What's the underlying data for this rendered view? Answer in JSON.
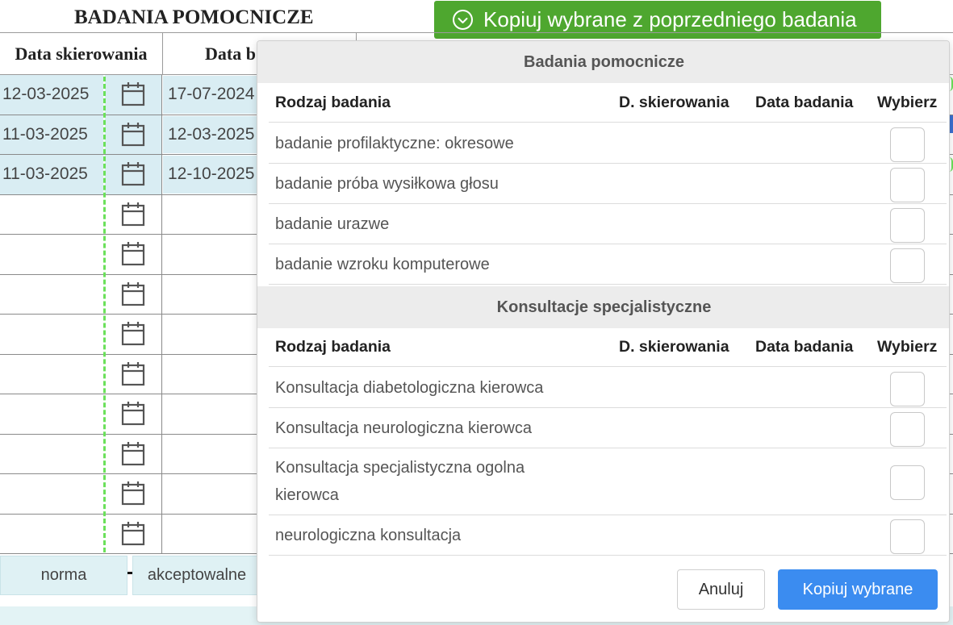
{
  "page": {
    "title": "BADANIA POMOCNICZE",
    "copy_previous_label": "Kopiuj wybrane z poprzedniego badania",
    "table": {
      "col1_header": "Data skierowania",
      "col2_header": "Data b",
      "rows": [
        {
          "ref_date": "12-03-2025",
          "exam_date": "17-07-2024"
        },
        {
          "ref_date": "11-03-2025",
          "exam_date": "12-03-2025"
        },
        {
          "ref_date": "11-03-2025",
          "exam_date": "12-10-2025"
        },
        {
          "ref_date": "",
          "exam_date": ""
        },
        {
          "ref_date": "",
          "exam_date": ""
        },
        {
          "ref_date": "",
          "exam_date": ""
        },
        {
          "ref_date": "",
          "exam_date": ""
        },
        {
          "ref_date": "",
          "exam_date": ""
        },
        {
          "ref_date": "",
          "exam_date": ""
        },
        {
          "ref_date": "",
          "exam_date": ""
        },
        {
          "ref_date": "",
          "exam_date": ""
        },
        {
          "ref_date": "",
          "exam_date": ""
        }
      ]
    },
    "legend": [
      "norma",
      "akceptowalne"
    ]
  },
  "modal": {
    "sections": [
      {
        "title": "Badania pomocnicze",
        "columns": {
          "type": "Rodzaj badania",
          "ref": "D. skierowania",
          "date": "Data badania",
          "select": "Wybierz"
        },
        "rows": [
          {
            "name": "badanie profilaktyczne: okresowe"
          },
          {
            "name": "badanie próba wysiłkowa głosu"
          },
          {
            "name": "badanie urazwe"
          },
          {
            "name": "badanie wzroku komputerowe"
          }
        ]
      },
      {
        "title": "Konsultacje specjalistyczne",
        "columns": {
          "type": "Rodzaj badania",
          "ref": "D. skierowania",
          "date": "Data badania",
          "select": "Wybierz"
        },
        "rows": [
          {
            "name": "Konsultacja diabetologiczna kierowca"
          },
          {
            "name": "Konsultacja neurologiczna kierowca"
          },
          {
            "name": "Konsultacja specjalistyczna ogolna kierowca"
          },
          {
            "name": "neurologiczna konsultacja"
          }
        ]
      }
    ],
    "cancel_label": "Anuluj",
    "copy_label": "Kopiuj wybrane"
  },
  "colors": {
    "green_button": "#4ea72f",
    "primary_button": "#3b8cf0",
    "row_fill": "#d9edf3",
    "dashed_line": "#6be05a"
  },
  "icons": {
    "copy_previous": "check-circle-icon",
    "date_picker": "calendar-icon"
  }
}
